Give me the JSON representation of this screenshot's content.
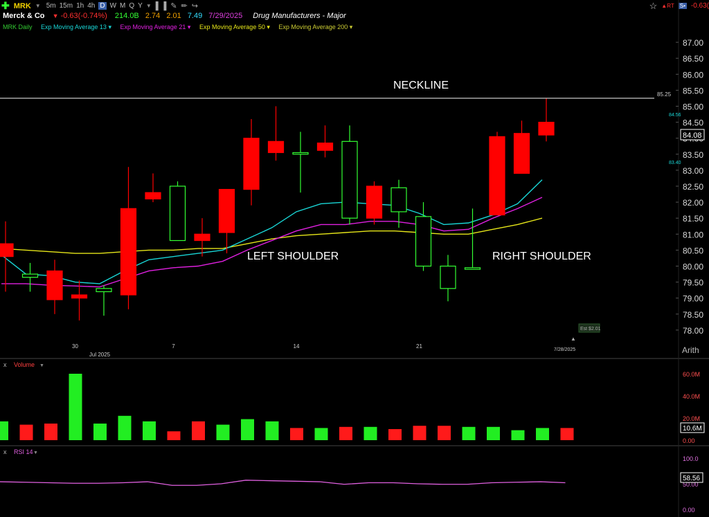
{
  "header": {
    "symbol": "MRK",
    "company": "Merck & Co",
    "change": "-0.63(-0.74%)",
    "market_cap": "214.0B",
    "stat2": "2.74",
    "stat3": "2.01",
    "stat4": "7.49",
    "date": "7/29/2025",
    "industry": "Drug Manufacturers - Major",
    "right_change": "-0.63(",
    "timeframes": [
      "5m",
      "15m",
      "1h",
      "4h",
      "D",
      "W",
      "M",
      "Q",
      "Y"
    ],
    "active_timeframe": "D",
    "colors": {
      "symbol": "#f0d000",
      "down": "#ff3030",
      "up": "#33ff33",
      "date": "#e040e0"
    }
  },
  "studies": {
    "price_label": "MRK Daily",
    "ema13": "Exp Moving Average 13",
    "ema21": "Exp Moving Average 21",
    "ema50": "Exp Moving Average 50",
    "ema200": "Exp Moving Average 200",
    "colors": {
      "price": "#33cc33",
      "ema13": "#19d6d6",
      "ema21": "#e020e0",
      "ema50": "#e6e619",
      "ema200": "#cccc33"
    }
  },
  "annotations": {
    "neckline": "NECKLINE",
    "left_shoulder": "LEFT SHOULDER",
    "right_shoulder": "RIGHT SHOULDER",
    "neckline_value": "85.25",
    "ema_tag_top": "84.56",
    "ema_tag_mid": "83.40",
    "est_label": "Est $2.01",
    "last_price": "84.08",
    "scale_mode": "Arith",
    "last_date": "7/28/2025"
  },
  "volume_panel": {
    "label": "Volume",
    "ticks": [
      "60.0M",
      "40.0M",
      "20.0M",
      "0.00"
    ],
    "last": "10.6M"
  },
  "rsi_panel": {
    "label": "RSI 14",
    "ticks": [
      "100.0",
      "50.00",
      "0.00"
    ],
    "last": "58.56"
  },
  "chart_data": {
    "type": "candlestick",
    "x": [
      "6/25",
      "6/26",
      "6/27",
      "6/30",
      "7/1",
      "7/2",
      "7/3",
      "7/7",
      "7/8",
      "7/9",
      "7/10",
      "7/11",
      "7/14",
      "7/15",
      "7/16",
      "7/17",
      "7/18",
      "7/21",
      "7/22",
      "7/23",
      "7/24",
      "7/25",
      "7/28"
    ],
    "x_tick_labels": [
      {
        "index": 3,
        "label": "30"
      },
      {
        "index": 4,
        "label": "Jul 2025"
      },
      {
        "index": 7,
        "label": "7"
      },
      {
        "index": 12,
        "label": "14"
      },
      {
        "index": 17,
        "label": "21"
      }
    ],
    "open": [
      80.7,
      79.65,
      79.85,
      79.1,
      79.2,
      81.8,
      82.3,
      80.8,
      81.0,
      82.4,
      84.0,
      83.9,
      83.5,
      83.85,
      81.5,
      82.5,
      81.7,
      80.0,
      79.3,
      79.9,
      84.05,
      84.15,
      84.5
    ],
    "high": [
      81.4,
      80.1,
      80.2,
      79.55,
      79.4,
      83.1,
      82.9,
      82.65,
      81.5,
      82.4,
      84.6,
      85.0,
      84.2,
      84.4,
      84.4,
      82.65,
      82.7,
      82.0,
      80.35,
      81.8,
      84.2,
      84.55,
      85.25
    ],
    "low": [
      79.2,
      79.2,
      78.5,
      78.3,
      78.45,
      78.65,
      82.0,
      80.8,
      80.3,
      80.4,
      81.9,
      83.3,
      82.3,
      83.4,
      81.3,
      81.3,
      81.2,
      79.85,
      78.9,
      79.9,
      82.45,
      83.6,
      83.9
    ],
    "close": [
      80.3,
      79.75,
      78.95,
      79.0,
      79.3,
      79.1,
      82.1,
      82.5,
      80.8,
      81.05,
      82.4,
      83.55,
      83.55,
      83.62,
      83.9,
      81.5,
      82.45,
      81.55,
      80.0,
      79.95,
      81.6,
      82.9,
      84.1
    ],
    "candles_note_removed": true,
    "ema13": [
      80.35,
      79.75,
      79.7,
      79.5,
      79.45,
      79.85,
      80.2,
      80.3,
      80.4,
      80.5,
      80.85,
      81.2,
      81.7,
      81.95,
      82.0,
      81.95,
      81.9,
      81.65,
      81.3,
      81.35,
      81.6,
      81.95,
      82.7
    ],
    "ema21": [
      79.45,
      79.45,
      79.4,
      79.38,
      79.35,
      79.6,
      79.85,
      79.95,
      80.0,
      80.15,
      80.5,
      80.8,
      81.1,
      81.3,
      81.3,
      81.4,
      81.4,
      81.3,
      81.1,
      81.15,
      81.5,
      81.8,
      82.15
    ],
    "ema50": [
      80.55,
      80.5,
      80.45,
      80.4,
      80.4,
      80.45,
      80.5,
      80.5,
      80.55,
      80.55,
      80.7,
      80.85,
      80.95,
      81.0,
      81.05,
      81.1,
      81.1,
      81.05,
      81.0,
      81.0,
      81.15,
      81.3,
      81.5
    ],
    "ylim": [
      77.5,
      87.5
    ],
    "y_ticks": [
      78.0,
      78.5,
      79.0,
      79.5,
      80.0,
      80.5,
      81.0,
      81.5,
      82.0,
      82.5,
      83.0,
      83.5,
      84.0,
      84.5,
      85.0,
      85.5,
      86.0,
      86.5,
      87.0
    ],
    "neckline": 85.25,
    "volume": [
      17,
      14,
      15,
      60,
      15,
      22,
      17,
      8,
      17,
      14,
      19,
      17,
      11,
      11,
      12,
      12,
      10,
      13,
      13,
      12,
      12,
      9,
      11,
      11
    ],
    "volume_up": [
      true,
      false,
      false,
      true,
      true,
      true,
      true,
      false,
      false,
      true,
      true,
      true,
      false,
      true,
      false,
      true,
      false,
      false,
      false,
      true,
      true,
      true,
      true,
      false
    ],
    "volume_ylim": [
      0,
      65
    ],
    "rsi": [
      54,
      53,
      52,
      51,
      51,
      52,
      54,
      47,
      47,
      50,
      57,
      56,
      55,
      54,
      49,
      52,
      52,
      50,
      49,
      49,
      52,
      53,
      54,
      52
    ],
    "rsi_ylim": [
      0,
      100
    ]
  }
}
